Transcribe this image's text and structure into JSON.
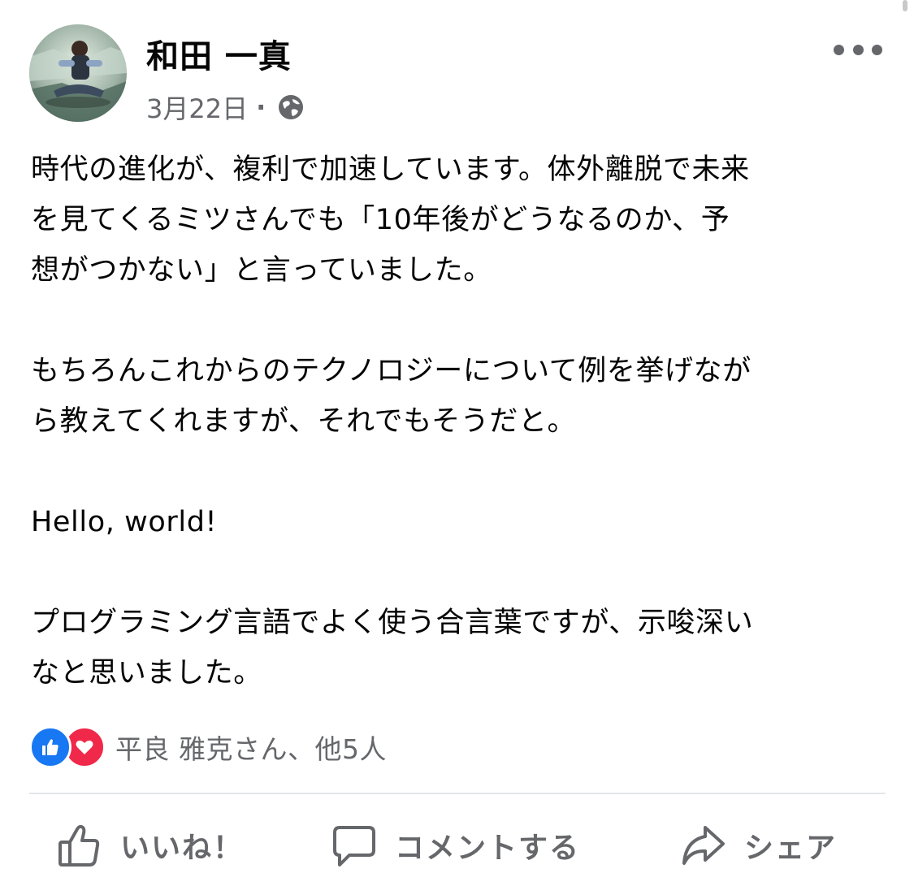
{
  "post": {
    "author": "和田 一真",
    "date": "3月22日",
    "separator": "·",
    "privacy_icon": "globe-icon",
    "more_icon": "more-dots-icon",
    "body": [
      "時代の進化が、複利で加速しています。体外離脱で未来",
      "を見てくるミツさんでも「10年後がどうなるのか、予",
      "想がつかない」と言っていました。",
      "",
      "もちろんこれからのテクノロジーについて例を挙げなが",
      "ら教えてくれますが、それでもそうだと。",
      "",
      "Hello, world!",
      "",
      "プログラミング言語でよく使う合言葉ですが、示唆深い",
      "なと思いました。"
    ]
  },
  "reactions": {
    "icons": [
      "like-reaction-icon",
      "love-reaction-icon"
    ],
    "summary": "平良 雅克さん、他5人"
  },
  "actions": {
    "like": {
      "label": "いいね！",
      "icon": "thumbs-up-icon"
    },
    "comment": {
      "label": "コメントする",
      "icon": "comment-bubble-icon"
    },
    "share": {
      "label": "シェア",
      "icon": "share-arrow-icon"
    }
  },
  "colors": {
    "text": "#050505",
    "secondary_text": "#65676b",
    "like_blue": "#1877f2",
    "love_red": "#f0284a",
    "divider": "#e4e6eb"
  }
}
